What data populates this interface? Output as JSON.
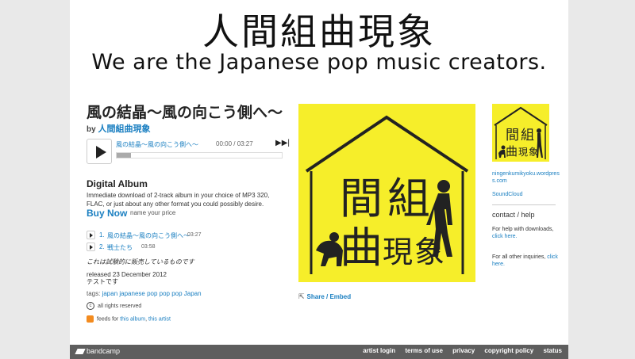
{
  "header": {
    "title": "人間組曲現象",
    "subtitle": "We are the Japanese pop music creators."
  },
  "album": {
    "title": "風の結晶〜風の向こう側へ〜",
    "by_prefix": "by",
    "artist": "人間組曲現象"
  },
  "player": {
    "track_name": "風の結晶〜風の向こう側へ〜",
    "time": "00:00 / 03:27"
  },
  "purchase": {
    "heading": "Digital Album",
    "description": "Immediate download of 2-track album in your choice of MP3 320, FLAC, or just about any other format you could possibly desire.",
    "buy_label": "Buy Now",
    "price_hint": "name your price"
  },
  "tracks": [
    {
      "num": "1.",
      "title": "風の結晶〜風の向こう側へ〜",
      "duration": "03:27"
    },
    {
      "num": "2.",
      "title": "戦士たち",
      "duration": "03:58"
    }
  ],
  "note": "これは試験的に販売しているものです",
  "released": {
    "date": "released 23 December 2012",
    "text": "テストです"
  },
  "tags": {
    "label": "tags:",
    "items": "japan japanese pop pop pop Japan"
  },
  "rights": "all rights reserved",
  "feeds": {
    "label": "feeds for",
    "album": "this album",
    "artist": "this artist"
  },
  "share_label": "Share / Embed",
  "artwork": {
    "chars": [
      "間",
      "組",
      "曲",
      "現",
      "象"
    ]
  },
  "sidebar": {
    "art_chars": [
      "間",
      "組",
      "曲",
      "現",
      "象"
    ],
    "link1": "ningenkumikyoku.wordpress.com",
    "link2": "SoundCloud",
    "contact": "contact / help",
    "help1_text": "For help with downloads,",
    "help1_link": "click here.",
    "help2_text": "For all other inquiries,",
    "help2_link": "click here."
  },
  "footer": {
    "logo": "bandcamp",
    "links": [
      "artist login",
      "terms of use",
      "privacy",
      "copyright policy",
      "status"
    ]
  },
  "colors": {
    "accent": "#1a7fc1",
    "art_bg": "#f6ee2a",
    "footer_bg": "#5e5e5e"
  },
  "icons": {
    "play": "play-icon",
    "next": "next-track-icon",
    "share": "share-icon",
    "rss": "rss-icon",
    "cc": "copyright-icon"
  }
}
